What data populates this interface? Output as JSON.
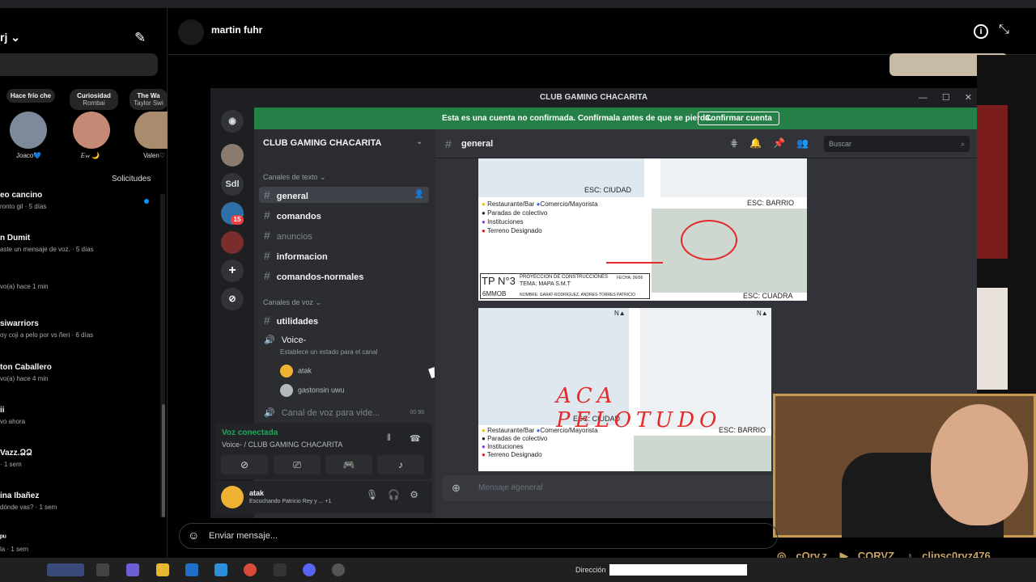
{
  "instagram": {
    "username": "rj",
    "notes": [
      {
        "text": "Hace frío che",
        "sub": ""
      },
      {
        "text": "Curiosidad",
        "sub": "Rombai"
      },
      {
        "text": "The Wa",
        "sub": "Taylor Swi"
      }
    ],
    "stories": [
      "Joaco💙",
      "𝐸𝓇𝒾 🌙",
      "Valen♡"
    ],
    "requests_label": "Solicitudes",
    "chats": [
      {
        "name": "eo cancino",
        "preview": "ronto gil · 5 días"
      },
      {
        "name": "n Dumit",
        "preview": "aste un mensaje de voz. · 5 días"
      },
      {
        "name": "",
        "preview": "vo(a) hace 1 min"
      },
      {
        "name": "siwarriors",
        "preview": "oy coji a pelo por vs ñeri · 6 días"
      },
      {
        "name": "ton Caballero",
        "preview": "vo(a) hace 4 min"
      },
      {
        "name": "ii",
        "preview": "vo ahora"
      },
      {
        "name": "Vazz.ՁՁ",
        "preview": "· 1 sem"
      },
      {
        "name": "ina Ibañez",
        "preview": "dónde vas? · 1 sem"
      },
      {
        "name": "ᵖᵘ",
        "preview": "la · 1 sem"
      }
    ],
    "contact_name": "martin fuhr",
    "message_placeholder": "Enviar mensaje..."
  },
  "discord": {
    "window_title": "CLUB GAMING CHACARITA",
    "window_buttons": [
      "—",
      "☐",
      "✕"
    ],
    "banner_text": "Esta es una cuenta no confirmada. Confírmala antes de que se pierda.",
    "banner_button": "Confirmar cuenta",
    "server_label": "Sdl",
    "server_badge": "15",
    "guild_name": "CLUB GAMING CHACARITA",
    "text_category": "Canales de texto",
    "text_channels": [
      {
        "name": "general",
        "state": "active"
      },
      {
        "name": "comandos",
        "state": "unread"
      },
      {
        "name": "anuncios",
        "state": "muted"
      },
      {
        "name": "informacion",
        "state": "unread"
      },
      {
        "name": "comandos-normales",
        "state": "unread"
      }
    ],
    "voice_category": "Canales de voz",
    "voice_channels": [
      {
        "name": "utilidades",
        "type": "text"
      },
      {
        "name": "Voice-",
        "type": "voice",
        "status": "Establece un estado para el canal"
      },
      {
        "name": "Canal de voz para vide...",
        "type": "voice",
        "counts": [
          "00",
          "99"
        ]
      }
    ],
    "voice_users": [
      "atak",
      "gastonsin uwu"
    ],
    "voice_connected": "Voz conectada",
    "voice_location": "Voice- / CLUB GAMING CHACARITA",
    "user": {
      "name": "atak",
      "activity": "Escuchando Patricio Rey y ...",
      "extra": "+1"
    },
    "channel_name": "general",
    "search_placeholder": "Buscar",
    "message_placeholder": "Mensaje #general",
    "map1": {
      "scale_city": "ESC: CIUDAD",
      "scale_barrio": "ESC: BARRIO",
      "scale_cuadra": "ESC: CUADRA",
      "legend": [
        "Restaurante/Bar",
        "Comercio/Mayorista",
        "Paradas de colectivo",
        "Instituciones",
        "Terreno Designado"
      ],
      "tp": "TP N°3",
      "project": "PROYECCION DE CONSTRUCCIONES",
      "tema": "TEMA: MAPA S.M.T",
      "fecha": "FECHA: 06/06",
      "code": "6MMOB",
      "names": "NOMBRE: GARAT-RODRIGUEZ, ANDRES-TORRES PATRICIO"
    },
    "map2": {
      "scale_city": "ESC: CIUDAD",
      "scale_barrio": "ESC: BARRIO",
      "scribble": "ACA PELOTUDO",
      "legend": [
        "Restaurante/Bar",
        "Comercio/Mayorista",
        "Paradas de colectivo",
        "Instituciones",
        "Terreno Designado"
      ]
    }
  },
  "stream": {
    "socials": [
      "cOrv.z",
      "CORVZ",
      "clipsc0rvz476"
    ]
  },
  "taskbar": {
    "address_label": "Dirección"
  },
  "colors": {
    "discord_green": "#248046",
    "discord_bg": "#313338",
    "instagram_bg": "#000000"
  }
}
